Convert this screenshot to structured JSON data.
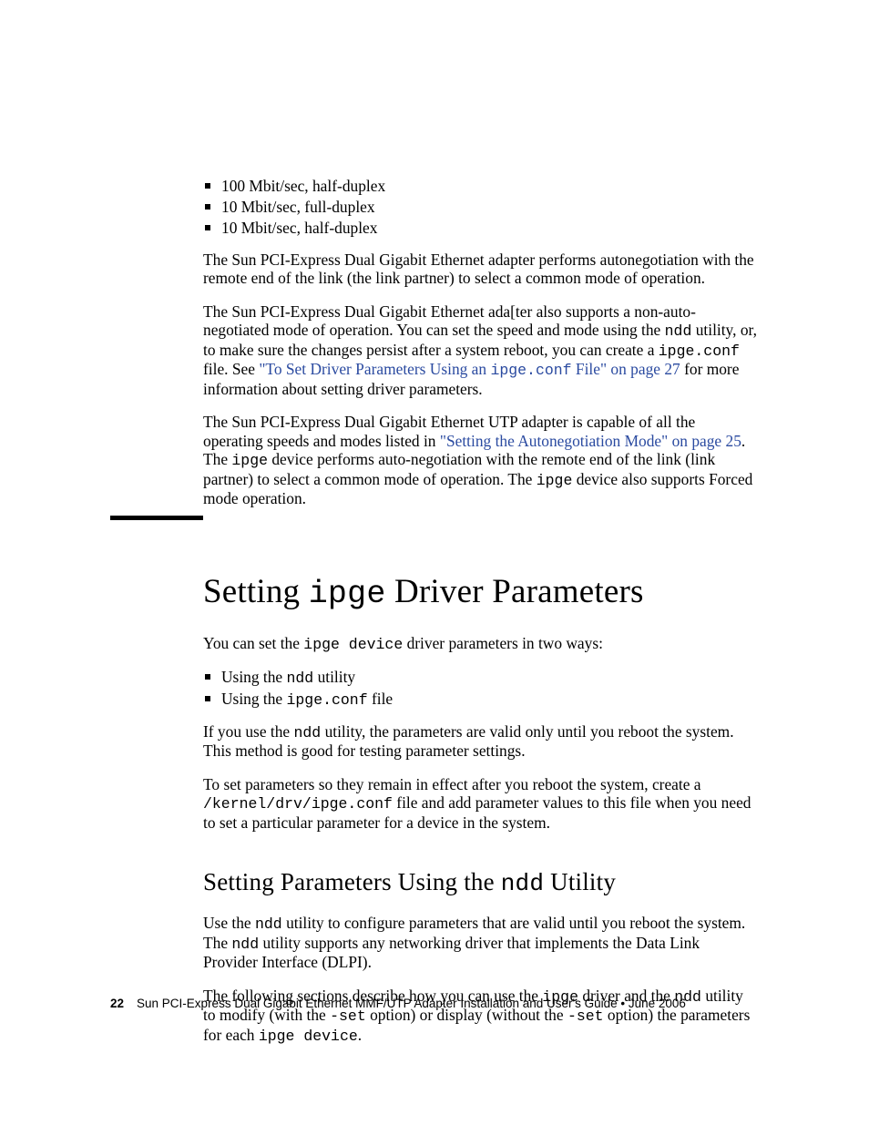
{
  "bullets1": {
    "b1": "100 Mbit/sec, half-duplex",
    "b2": "10 Mbit/sec, full-duplex",
    "b3": "10 Mbit/sec, half-duplex"
  },
  "para1": "The Sun PCI-Express Dual Gigabit Ethernet adapter performs autonegotiation with the remote end of the link (the link partner) to select a common mode of operation.",
  "para2": {
    "a": "The Sun PCI-Express Dual Gigabit Ethernet ada[ter also supports a non-auto-negotiated mode of operation. You can set the speed and mode using the ",
    "ndd": "ndd",
    "b": " utility, or, to make sure the changes persist after a system reboot, you can create a ",
    "conf": "ipge.conf",
    "c": " file. See ",
    "link_a": "\"To Set Driver Parameters Using an ",
    "link_code": "ipge.conf",
    "link_b": " File\" on page 27",
    "d": " for more information about setting driver parameters."
  },
  "para3": {
    "a": "The Sun PCI-Express Dual Gigabit Ethernet UTP adapter is capable of all the operating speeds and modes listed in ",
    "link": "\"Setting the Autonegotiation Mode\" on page 25",
    "b": ". The ",
    "ipge1": "ipge",
    "c": " device performs auto-negotiation with the remote end of the link (link partner) to select a common mode of operation. The ",
    "ipge2": "ipge",
    "d": " device also supports Forced mode operation."
  },
  "heading": {
    "a": "Setting ",
    "code": "ipge",
    "b": " Driver Parameters"
  },
  "set_intro": {
    "a": "You can set the ",
    "code": "ipge device",
    "b": " driver parameters in two ways:"
  },
  "bullets2": {
    "b1a": "Using the ",
    "b1code": "ndd",
    "b1b": " utility",
    "b2a": "Using the ",
    "b2code": "ipge.conf",
    "b2b": " file"
  },
  "para4": {
    "a": "If you use the ",
    "code": "ndd",
    "b": " utility, the parameters are valid only until you reboot the system. This method is good for testing parameter settings."
  },
  "para5": {
    "a": "To set parameters so they remain in effect after you reboot the system, create a ",
    "code": "/kernel/drv/ipge.conf",
    "b": " file and add parameter values to this file when you need to set a particular parameter for a device in the system."
  },
  "sub_heading": {
    "a": "Setting Parameters Using the ",
    "code": "ndd",
    "b": " Utility"
  },
  "para6": {
    "a": "Use the ",
    "ndd1": "ndd",
    "b": " utility to configure parameters that are valid until you reboot the system. The ",
    "ndd2": "ndd",
    "c": " utility supports any networking driver that implements the Data Link Provider Interface (DLPI)."
  },
  "para7": {
    "a": "The following sections describe how you can use the ",
    "ipge1": "ipge",
    "b": " driver and the ",
    "ndd": "ndd",
    "c": " utility to modify (with the ",
    "set1": "-set",
    "d": " option) or display (without the ",
    "set2": "-set",
    "e": " option) the parameters for each ",
    "ipge2": "ipge device",
    "f": "."
  },
  "footer": {
    "page": "22",
    "text": "Sun PCI-Express Dual Gigabit Ethernet MMF/UTP Adapter Installation and User's Guide  •  June 2006"
  }
}
